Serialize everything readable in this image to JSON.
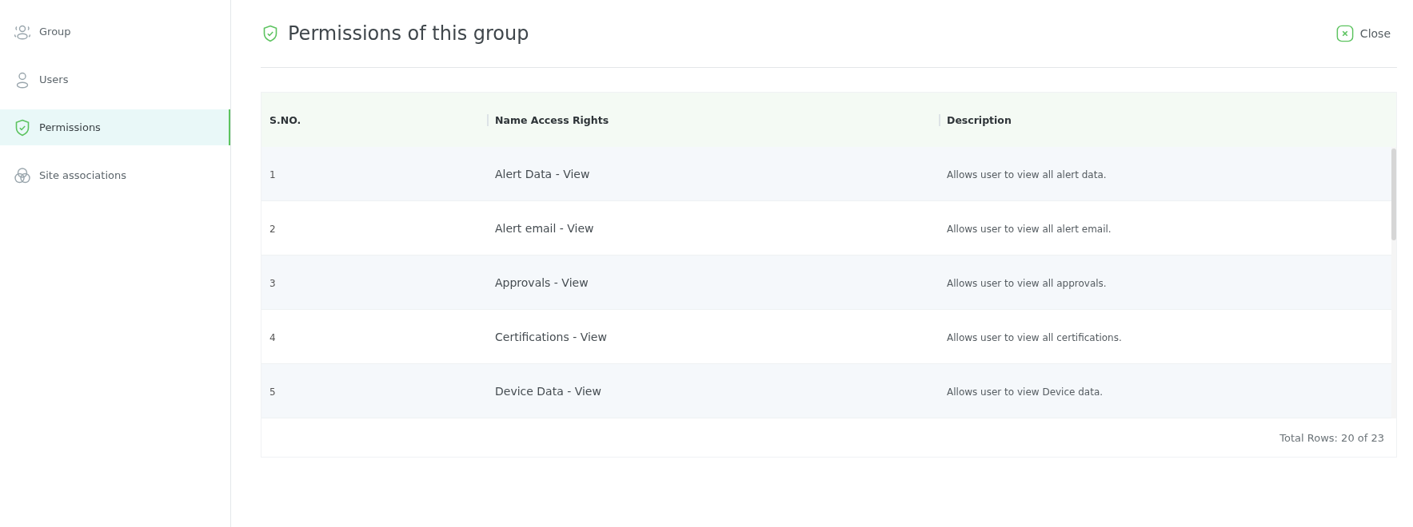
{
  "sidebar": {
    "items": [
      {
        "label": "Group",
        "kind": "group",
        "selected": false
      },
      {
        "label": "Users",
        "kind": "user",
        "selected": false
      },
      {
        "label": "Permissions",
        "kind": "permission",
        "selected": true
      },
      {
        "label": "Site associations",
        "kind": "site",
        "selected": false
      }
    ]
  },
  "header": {
    "title": "Permissions of this group",
    "close_label": "Close"
  },
  "table": {
    "columns": [
      "S.NO.",
      "Name Access Rights",
      "Description"
    ],
    "rows": [
      {
        "sno": "1",
        "name": "Alert Data - View",
        "description": "Allows user to view all alert data."
      },
      {
        "sno": "2",
        "name": "Alert email - View",
        "description": "Allows user to view all alert email."
      },
      {
        "sno": "3",
        "name": "Approvals - View",
        "description": "Allows user to view all approvals."
      },
      {
        "sno": "4",
        "name": "Certifications - View",
        "description": "Allows user to view all certifications."
      },
      {
        "sno": "5",
        "name": "Device Data - View",
        "description": "Allows user to view Device data."
      }
    ],
    "footer": "Total Rows: 20 of 23"
  }
}
